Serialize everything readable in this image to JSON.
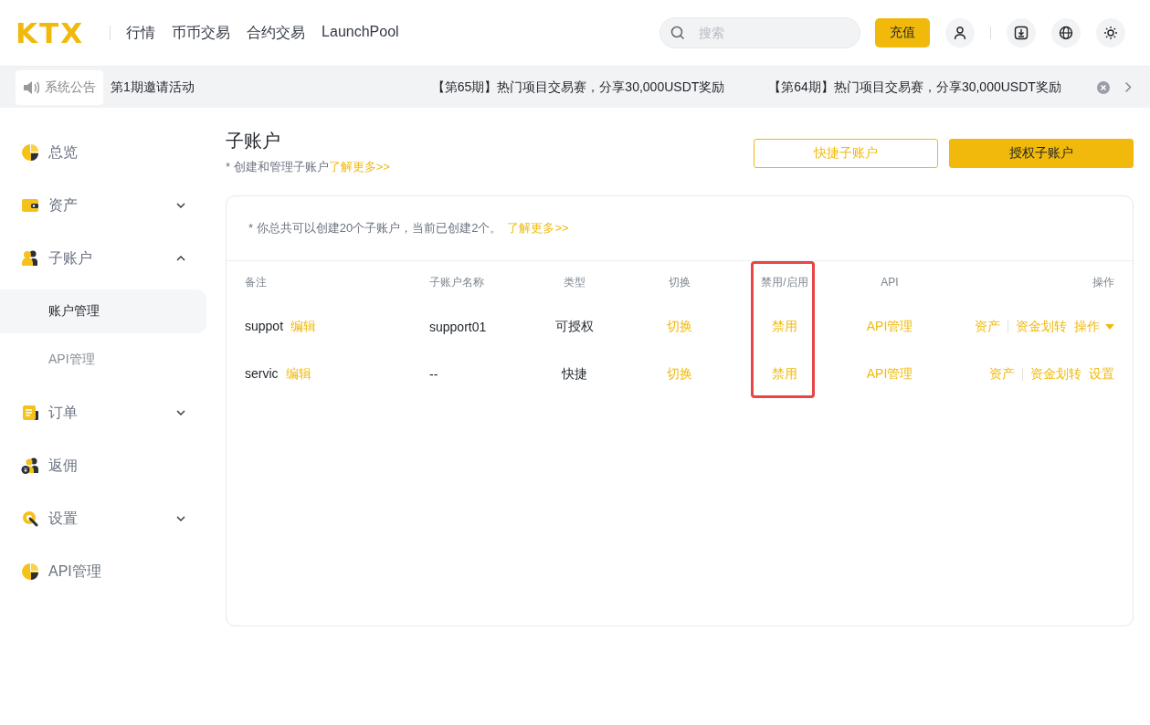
{
  "header": {
    "logo": "KTX",
    "nav": [
      {
        "label": "行情"
      },
      {
        "label": "币币交易"
      },
      {
        "label": "合约交易"
      },
      {
        "label": "LaunchPool"
      }
    ],
    "search": {
      "placeholder": "搜索"
    },
    "deposit_button": "充值"
  },
  "announcement": {
    "label": "系统公告",
    "items": [
      "第1期邀请活动",
      "【第65期】热门项目交易赛，分享30,000USDT奖励",
      "【第64期】热门项目交易赛，分享30,000USDT奖励"
    ]
  },
  "sidebar": {
    "items": [
      {
        "label": "总览",
        "kind": "chart",
        "selected": false
      },
      {
        "label": "资产",
        "kind": "wallet",
        "selected": false,
        "expanded": false
      },
      {
        "label": "子账户",
        "kind": "users",
        "selected": false,
        "expanded": true,
        "children": [
          {
            "label": "账户管理",
            "selected": true
          },
          {
            "label": "API管理",
            "selected": false
          }
        ]
      },
      {
        "label": "订单",
        "kind": "order",
        "selected": false,
        "expanded": false
      },
      {
        "label": "返佣",
        "kind": "rebate",
        "selected": false
      },
      {
        "label": "设置",
        "kind": "settings",
        "selected": false,
        "expanded": false
      },
      {
        "label": "API管理",
        "kind": "chart",
        "selected": false
      }
    ]
  },
  "page": {
    "title": "子账户",
    "subtitle": "* 创建和管理子账户",
    "subtitle_link": "了解更多>>",
    "buttons": [
      {
        "label": "快捷子账户",
        "kind": "outline"
      },
      {
        "label": "授权子账户",
        "kind": "primary"
      }
    ]
  },
  "card": {
    "notice": "* 你总共可以创建20个子账户，当前已创建2个。",
    "notice_link": "了解更多>>"
  },
  "table": {
    "columns": [
      {
        "label": "备注",
        "highlighted": false
      },
      {
        "label": "子账户名称",
        "highlighted": false
      },
      {
        "label": "类型",
        "highlighted": false
      },
      {
        "label": "切换",
        "highlighted": false
      },
      {
        "label": "禁用/启用",
        "highlighted": true
      },
      {
        "label": "API",
        "highlighted": false
      },
      {
        "label": "操作",
        "highlighted": false
      }
    ],
    "rows": [
      {
        "note": "suppot",
        "edit": "编辑",
        "name": "support01",
        "type": "可授权",
        "switch": "切换",
        "toggle": "禁用",
        "api": "API管理",
        "actions": [
          {
            "label": "资产",
            "kind": "link"
          },
          {
            "label": "资金划转",
            "kind": "link"
          },
          {
            "label": "操作",
            "kind": "dropdown"
          }
        ]
      },
      {
        "note": "servic",
        "edit": "编辑",
        "name": "--",
        "type": "快捷",
        "switch": "切换",
        "toggle": "禁用",
        "api": "API管理",
        "actions": [
          {
            "label": "资产",
            "kind": "link"
          },
          {
            "label": "资金划转",
            "kind": "link"
          },
          {
            "label": "设置",
            "kind": "link"
          }
        ]
      }
    ]
  }
}
